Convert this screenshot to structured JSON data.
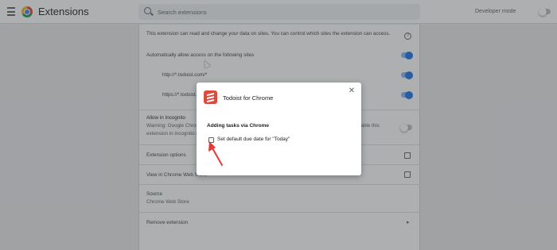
{
  "header": {
    "title": "Extensions",
    "search_placeholder": "Search extensions",
    "developer_mode_label": "Developer mode",
    "developer_mode_on": false
  },
  "details": {
    "access_text": "This extension can read and change your data on sites. You can control which sites the extension can access.",
    "auto_allow_label": "Automatically allow access on the following sites",
    "sites": [
      "http://*.todoist.com/*",
      "https://*.todoist.com/*"
    ],
    "incognito_title": "Allow in Incognito",
    "incognito_warning": "Warning: Google Chrome cannot prevent extensions from recording your browsing history. To disable this extension in incognito mode, unselect this option.",
    "extension_options_label": "Extension options",
    "webstore_label": "View in Chrome Web Store",
    "source_title": "Source",
    "source_value": "Chrome Web Store",
    "remove_label": "Remove extension"
  },
  "dialog": {
    "title": "Todoist for Chrome",
    "close_symbol": "✕",
    "section_heading": "Adding tasks via Chrome",
    "checkbox_label": "Set default due date for \"Today\"",
    "checkbox_checked": false
  },
  "colors": {
    "accent": "#1a73e8",
    "todoist_red": "#db4c3f",
    "annotation_red": "#e53935"
  }
}
